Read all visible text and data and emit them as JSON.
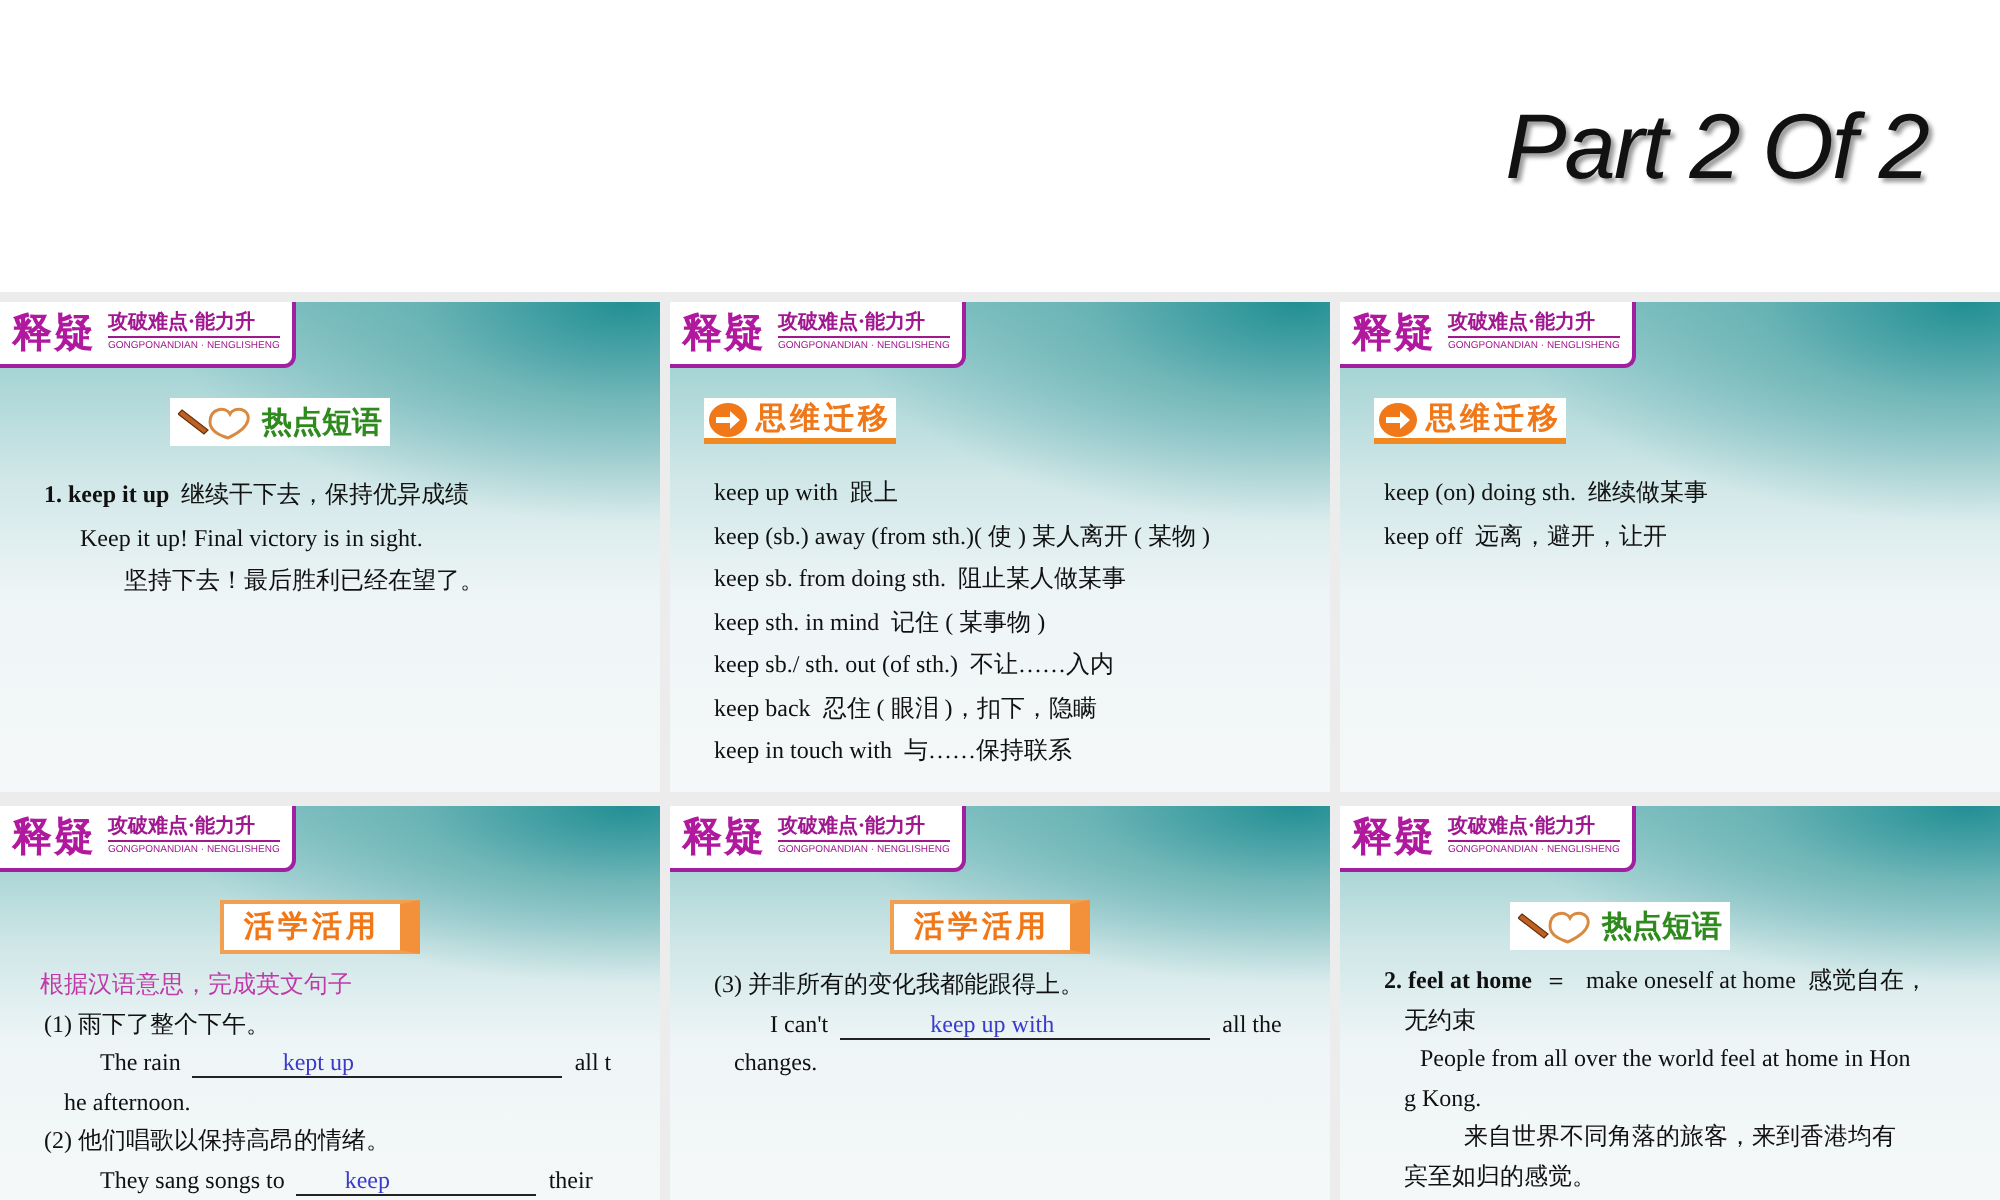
{
  "title": "Part 2 Of 2",
  "slides": [
    {
      "badge": {
        "main": "释疑",
        "sub": "攻破难点·能力升",
        "pinyin": "GONGPONANDIAN · NENGLISHENG"
      },
      "section": {
        "kind": "hot",
        "label": "热点短语"
      },
      "lines": [
        {
          "kind": "phrase",
          "text": "**1. keep it up**  继续干下去，保持优异成绩"
        },
        {
          "kind": "example",
          "text": "Keep it up! Final victory is in sight."
        },
        {
          "kind": "translation",
          "text": "坚持下去！最后胜利已经在望了。"
        }
      ]
    },
    {
      "badge": {
        "main": "释疑",
        "sub": "攻破难点·能力升",
        "pinyin": "GONGPONANDIAN · NENGLISHENG"
      },
      "section": {
        "kind": "think",
        "label": "思维迁移"
      },
      "lines": [
        {
          "kind": "plain",
          "text": "keep up with  跟上"
        },
        {
          "kind": "plain",
          "text": "keep (sb.) away (from sth.)( 使 ) 某人离开 ( 某物 )"
        },
        {
          "kind": "plain",
          "text": "keep sb. from doing sth.  阻止某人做某事"
        },
        {
          "kind": "plain",
          "text": "keep sth. in mind  记住 ( 某事物 )"
        },
        {
          "kind": "plain",
          "text": "keep sb./ sth. out (of sth.)  不让……入内"
        },
        {
          "kind": "plain",
          "text": "keep back  忍住 ( 眼泪 )，扣下，隐瞒"
        },
        {
          "kind": "plain",
          "text": "keep in touch with  与……保持联系"
        }
      ]
    },
    {
      "badge": {
        "main": "释疑",
        "sub": "攻破难点·能力升",
        "pinyin": "GONGPONANDIAN · NENGLISHENG"
      },
      "section": {
        "kind": "think",
        "label": "思维迁移"
      },
      "lines": [
        {
          "kind": "plain",
          "text": "keep (on) doing sth.  继续做某事"
        },
        {
          "kind": "plain",
          "text": "keep off  远离，避开，让开"
        }
      ]
    },
    {
      "badge": {
        "main": "释疑",
        "sub": "攻破难点·能力升",
        "pinyin": "GONGPONANDIAN · NENGLISHENG"
      },
      "section": {
        "kind": "practice",
        "label": "活学活用"
      },
      "lines": [
        {
          "kind": "prompt",
          "text": "根据汉语意思，完成英文句子"
        },
        {
          "kind": "plain",
          "text": "(1) 雨下了整个下午。"
        },
        {
          "kind": "fill",
          "before": "The rain",
          "answer": "kept up",
          "after": "all t"
        },
        {
          "kind": "cont",
          "text": "he afternoon."
        },
        {
          "kind": "plain",
          "text": "(2) 他们唱歌以保持高昂的情绪。"
        },
        {
          "kind": "fill",
          "before": "They sang songs to",
          "answer": "keep",
          "after": "their"
        }
      ]
    },
    {
      "badge": {
        "main": "释疑",
        "sub": "攻破难点·能力升",
        "pinyin": "GONGPONANDIAN · NENGLISHENG"
      },
      "section": {
        "kind": "practice",
        "label": "活学活用"
      },
      "lines": [
        {
          "kind": "plain",
          "text": "(3) 并非所有的变化我都能跟得上。"
        },
        {
          "kind": "fill",
          "before": "I can't",
          "answer": "keep up with",
          "after": "all the"
        },
        {
          "kind": "cont",
          "text": "changes."
        }
      ]
    },
    {
      "badge": {
        "main": "释疑",
        "sub": "攻破难点·能力升",
        "pinyin": "GONGPONANDIAN · NENGLISHENG"
      },
      "section": {
        "kind": "hot",
        "label": "热点短语"
      },
      "lines": [
        {
          "kind": "phrase",
          "text": "**2. feel at home**  ＝   make oneself at home  感觉自在，"
        },
        {
          "kind": "cont",
          "text": "无约束"
        },
        {
          "kind": "example",
          "text": "People from all over the world feel at home in Hon"
        },
        {
          "kind": "cont",
          "text": "g Kong."
        },
        {
          "kind": "translation",
          "text": "来自世界不同角落的旅客，来到香港均有"
        },
        {
          "kind": "cont",
          "text": "宾至如归的感觉。"
        }
      ]
    }
  ]
}
